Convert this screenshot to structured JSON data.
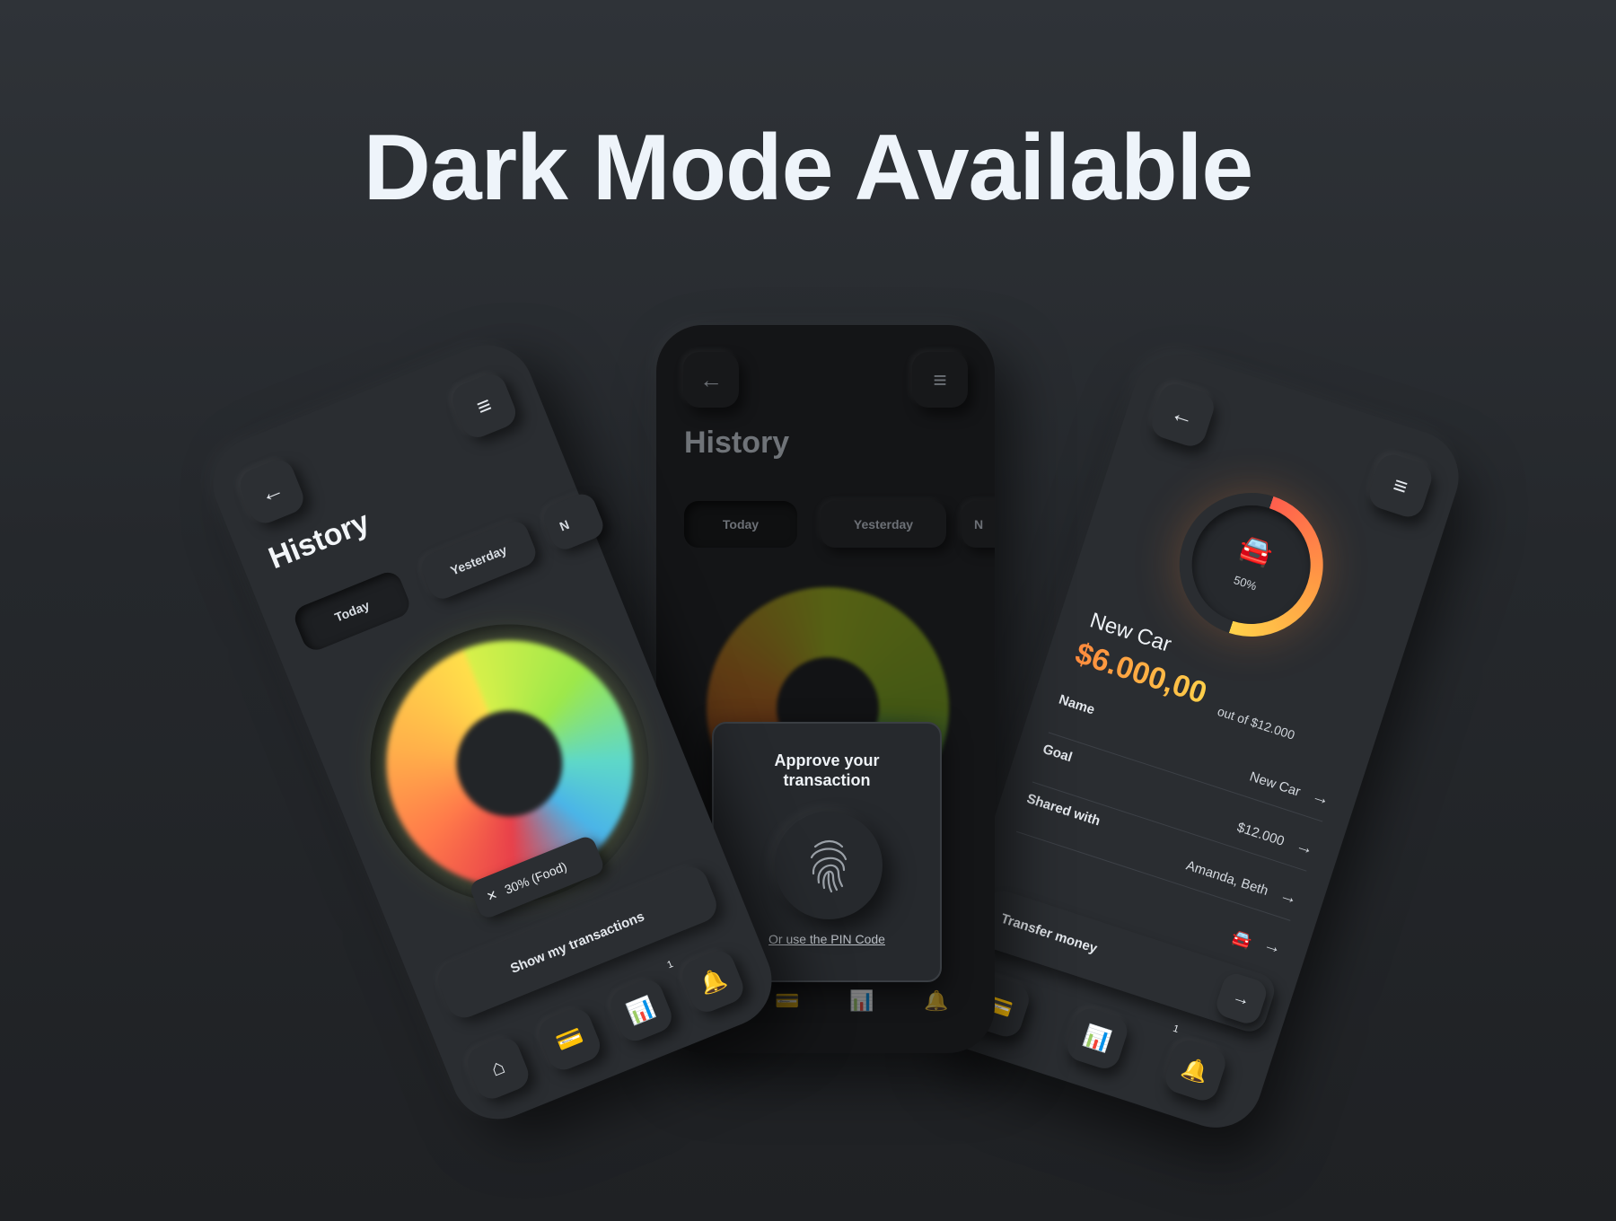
{
  "headline": "Dark Mode Available",
  "left_phone": {
    "back_icon": "arrow-left-icon",
    "menu_icon": "hamburger-menu-icon",
    "title": "History",
    "tabs": [
      "Today",
      "Yesterday",
      "N"
    ],
    "active_tab": "Today",
    "donut_badge": "30% (Food)",
    "badge_icon": "fork-knife-icon",
    "show_button": "Show my transactions",
    "nav": [
      "home-icon",
      "credit-card-icon",
      "chart-icon",
      "bell-icon"
    ],
    "notification_count": "1"
  },
  "center_phone": {
    "title": "History",
    "tabs": [
      "Today",
      "Yesterday",
      "N"
    ],
    "dialog": {
      "title": "Approve your transaction",
      "icon": "fingerprint-icon",
      "pin_link": "Or use the PIN Code"
    },
    "nav": [
      "credit-card-icon",
      "chart-icon",
      "bell-icon"
    ]
  },
  "right_phone": {
    "progress_percent": "50%",
    "progress_value": 50,
    "goal_title": "New Car",
    "amount": "$6.000,00",
    "amount_of": "out of $12.000",
    "rows": [
      {
        "label": "Name",
        "value": "New Car"
      },
      {
        "label": "Goal",
        "value": "$12.000"
      },
      {
        "label": "Shared with",
        "value": "Amanda, Beth"
      },
      {
        "label": "",
        "value": ""
      }
    ],
    "transfer_button": "Transfer money",
    "nav": [
      "credit-card-icon",
      "chart-icon",
      "bell-icon"
    ],
    "notification_count": "1"
  },
  "colors": {
    "background": "#2a2d31",
    "amount_start": "#ff8a3d",
    "amount_end": "#ffd04a",
    "ring_start": "#ff5e4d",
    "ring_end": "#ffd24a"
  }
}
